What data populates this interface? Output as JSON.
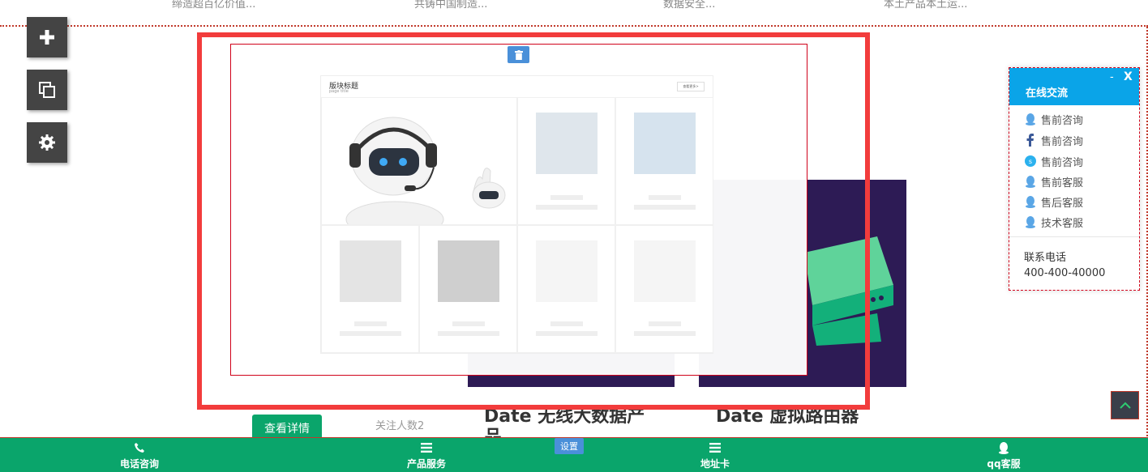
{
  "top_strip": {
    "items": [
      "缔造超百亿价值...",
      "共铸中国制造...",
      "数据安全...",
      "本土产品本土运..."
    ]
  },
  "tools": [
    {
      "icon": "plus-icon"
    },
    {
      "icon": "copy-icon"
    },
    {
      "icon": "gear-icon"
    }
  ],
  "preview": {
    "title": "版块标题",
    "subtitle": "page title",
    "more_label": "查看更多>"
  },
  "products": {
    "detail_button": "查看详情",
    "followers": "关注人数2",
    "item1_title": "Date 无线大数据产品",
    "item2_title": "Date 虚拟路由器"
  },
  "chat": {
    "title": "在线交流",
    "minimize": "-",
    "close": "X",
    "items": [
      {
        "icon": "qq-icon",
        "label": "售前咨询"
      },
      {
        "icon": "facebook-icon",
        "label": "售前咨询"
      },
      {
        "icon": "skype-icon",
        "label": "售前咨询"
      },
      {
        "icon": "qq-icon",
        "label": "售前客服"
      },
      {
        "icon": "qq-icon",
        "label": "售后客服"
      },
      {
        "icon": "qq-icon",
        "label": "技术客服"
      }
    ],
    "phone_label": "联系电话",
    "phone": "400-400-40000"
  },
  "bottom_bar": {
    "items": [
      {
        "icon": "phone-icon",
        "label": "电话咨询"
      },
      {
        "icon": "menu-icon",
        "label": "产品服务"
      },
      {
        "icon": "menu-icon",
        "label": "地址卡"
      },
      {
        "icon": "qq-icon",
        "label": "qq客服"
      }
    ],
    "settings_label": "设置"
  },
  "colors": {
    "accent_green": "#0aa56b",
    "chat_blue": "#0aa4e8",
    "highlight_red": "#f23c3c",
    "card_purple": "#2d1b55"
  }
}
